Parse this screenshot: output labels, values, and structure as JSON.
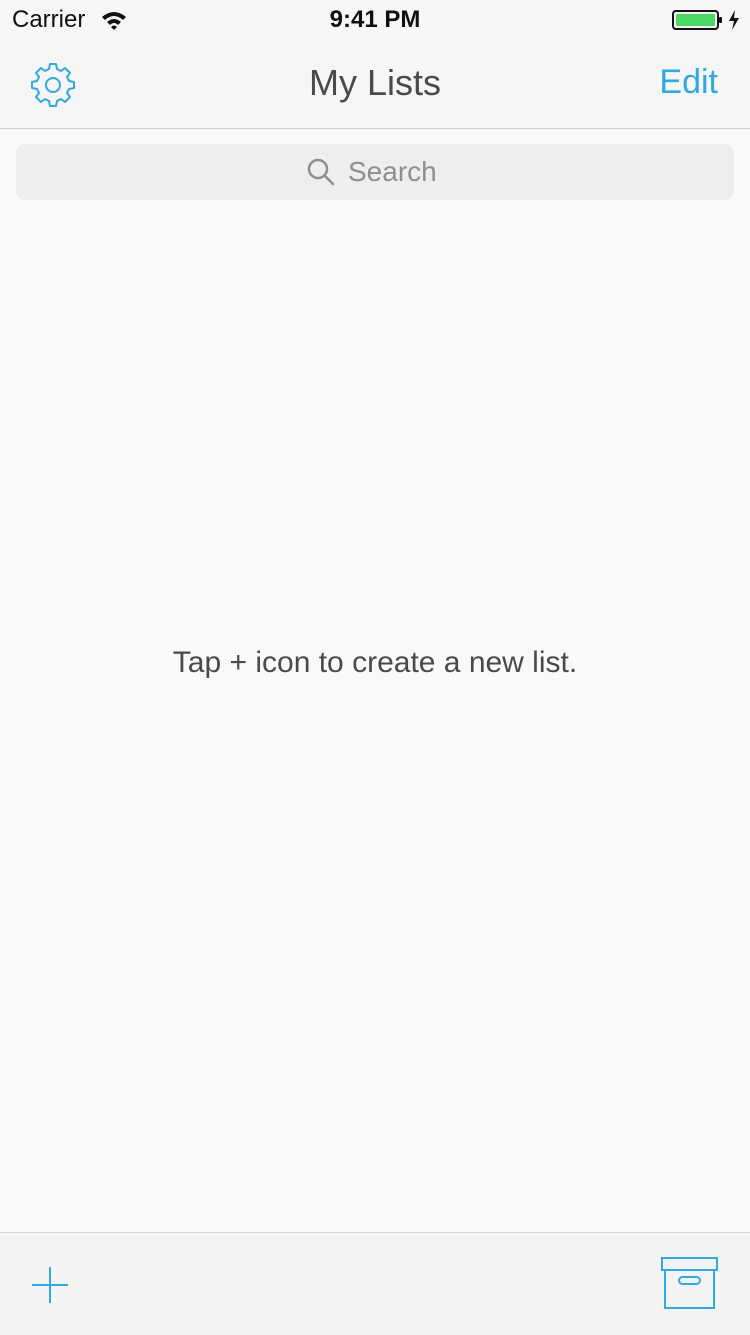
{
  "status_bar": {
    "carrier": "Carrier",
    "time": "9:41 PM",
    "icons": [
      "wifi-icon",
      "battery-icon",
      "charging-icon"
    ]
  },
  "nav_bar": {
    "title": "My Lists",
    "left_icon": "gear-icon",
    "edit_label": "Edit"
  },
  "search": {
    "placeholder": "Search",
    "value": ""
  },
  "empty_state": {
    "message": "Tap + icon to create a new list."
  },
  "toolbar": {
    "left_icon": "plus-icon",
    "right_icon": "archive-icon"
  },
  "colors": {
    "accent": "#2fa9e0",
    "battery": "#4cd964",
    "background": "#f9f9f9",
    "bar": "#f6f6f6",
    "text": "#4a4a4a"
  }
}
